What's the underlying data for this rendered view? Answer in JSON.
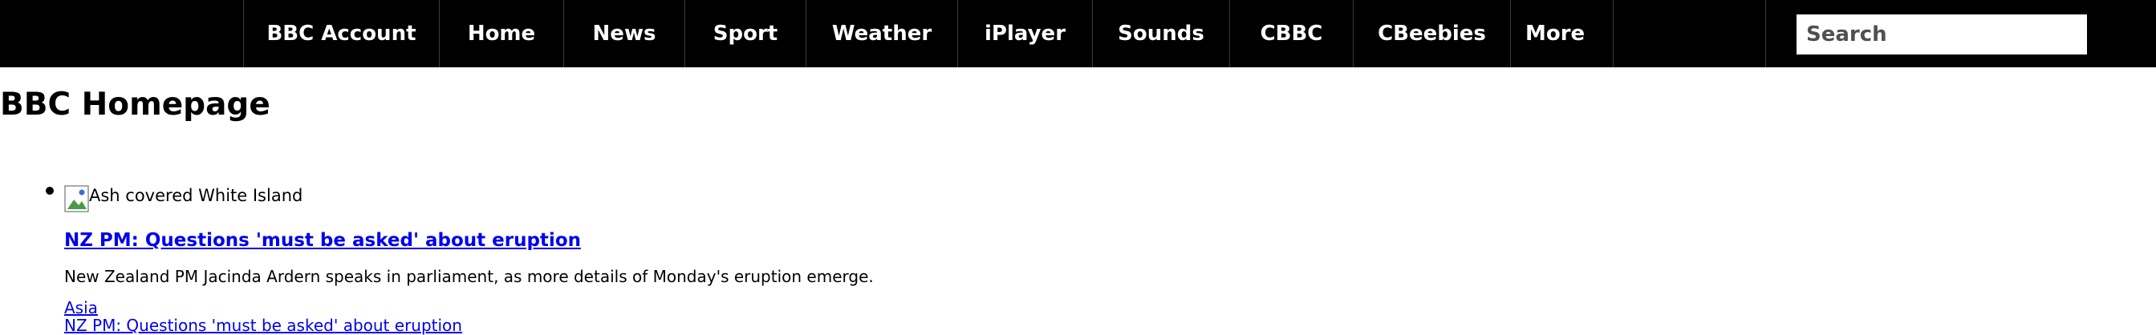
{
  "nav": {
    "items": [
      {
        "label": "BBC Account"
      },
      {
        "label": "Home"
      },
      {
        "label": "News"
      },
      {
        "label": "Sport"
      },
      {
        "label": "Weather"
      },
      {
        "label": "iPlayer"
      },
      {
        "label": "Sounds"
      },
      {
        "label": "CBBC"
      },
      {
        "label": "CBeebies"
      },
      {
        "label": "More"
      }
    ],
    "search_placeholder": "Search"
  },
  "page": {
    "title": "BBC Homepage"
  },
  "story": {
    "image_alt": "Ash covered White Island",
    "headline": "NZ PM: Questions 'must be asked' about eruption",
    "summary": "New Zealand PM Jacinda Ardern speaks in parliament, as more details of Monday's eruption emerge.",
    "tag": "Asia",
    "repeat_link": "NZ PM: Questions 'must be asked' about eruption"
  },
  "colors": {
    "topbar": "#000000",
    "link": "#0000ee"
  }
}
